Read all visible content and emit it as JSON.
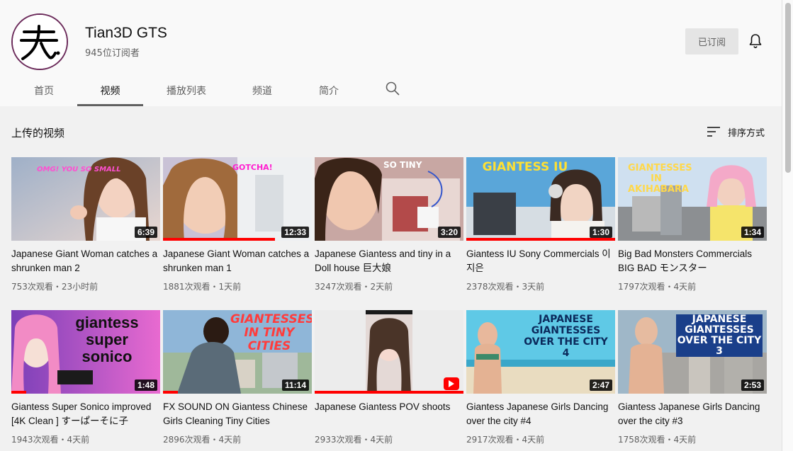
{
  "channel": {
    "name": "Tian3D GTS",
    "subscribers": "945位订阅者",
    "avatar_glyph": "天",
    "subscribe_label": "已订阅"
  },
  "tabs": [
    {
      "label": "首页",
      "active": false
    },
    {
      "label": "视频",
      "active": true
    },
    {
      "label": "播放列表",
      "active": false
    },
    {
      "label": "频道",
      "active": false
    },
    {
      "label": "简介",
      "active": false
    }
  ],
  "section": {
    "title": "上传的视频",
    "sort_label": "排序方式"
  },
  "videos": [
    {
      "title": "Japanese Giant Woman catches a shrunken man 2",
      "duration": "6:39",
      "meta": "753次观看・23小时前",
      "thumb_text": "OMG! YOU SO SMALL",
      "progress": 0
    },
    {
      "title": "Japanese Giant Woman catches a shrunken man 1",
      "duration": "12:33",
      "meta": "1881次观看・1天前",
      "thumb_text": "GOTCHA!",
      "progress": 0.75
    },
    {
      "title": "Japanese Giantess and tiny in a Doll house 巨大娘",
      "duration": "3:20",
      "meta": "3247次观看・2天前",
      "thumb_text": "SO TINY",
      "progress": 0
    },
    {
      "title": "Giantess IU Sony Commercials 이지은",
      "duration": "1:30",
      "meta": "2378次观看・3天前",
      "thumb_text": "GIANTESS IU",
      "progress": 1.0
    },
    {
      "title": "Big Bad Monsters Commercials BIG BAD モンスター",
      "duration": "1:34",
      "meta": "1797次观看・4天前",
      "thumb_text": "GIANTESSES IN AKIHABARA",
      "progress": 0
    },
    {
      "title": "Giantess Super Sonico improved [4K Clean ] すーぱーそに子",
      "duration": "1:48",
      "meta": "1943次观看・4天前",
      "thumb_text": "giantess super sonico",
      "progress": 0.1
    },
    {
      "title": "FX SOUND ON Giantess Chinese Girls Cleaning Tiny Cities",
      "duration": "11:14",
      "meta": "2896次观看・4天前",
      "thumb_text": "GIANTESSES IN TINY CITIES",
      "progress": 0.1
    },
    {
      "title": "Japanese Giantess POV shoots",
      "duration": "",
      "meta": "2933次观看・4天前",
      "thumb_text": "",
      "progress": 1.0
    },
    {
      "title": "Giantess Japanese Girls Dancing over the city #4",
      "duration": "2:47",
      "meta": "2917次观看・4天前",
      "thumb_text": "JAPANESE GIANTESSES OVER THE CITY 4",
      "progress": 0
    },
    {
      "title": "Giantess Japanese Girls Dancing over the city #3",
      "duration": "2:53",
      "meta": "1758次观看・4天前",
      "thumb_text": "JAPANESE GIANTESSES OVER THE CITY 3",
      "progress": 0
    }
  ],
  "colors": {
    "accent_red": "#ff0000",
    "text_primary": "#0f0f0f",
    "text_secondary": "#606060",
    "avatar_ring": "#6b2a5a"
  }
}
